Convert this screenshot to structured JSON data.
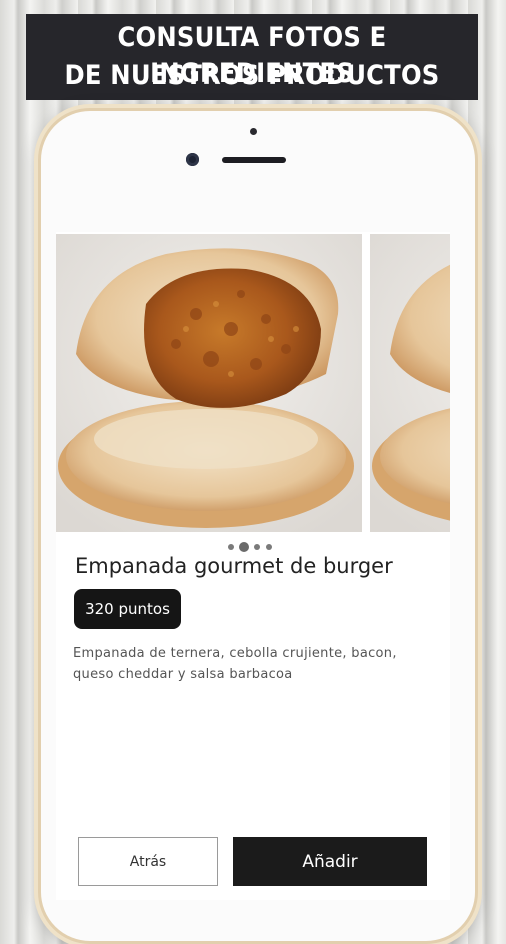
{
  "banner": {
    "line1": "CONSULTA FOTOS E INGREDIENTES",
    "line2": "DE NUESTROS PRODUCTOS"
  },
  "product": {
    "name": "Empanada gourmet de burger",
    "points_label": "320 puntos",
    "description": "Empanada de ternera, cebolla crujiente, bacon, queso cheddar y salsa barbacoa"
  },
  "carousel": {
    "page_count": 4,
    "active_index": 1
  },
  "actions": {
    "back_label": "Atrás",
    "add_label": "Añadir"
  },
  "colors": {
    "banner_bg": "#26262b",
    "primary_button": "#1b1b1b",
    "points_badge": "#151515"
  }
}
